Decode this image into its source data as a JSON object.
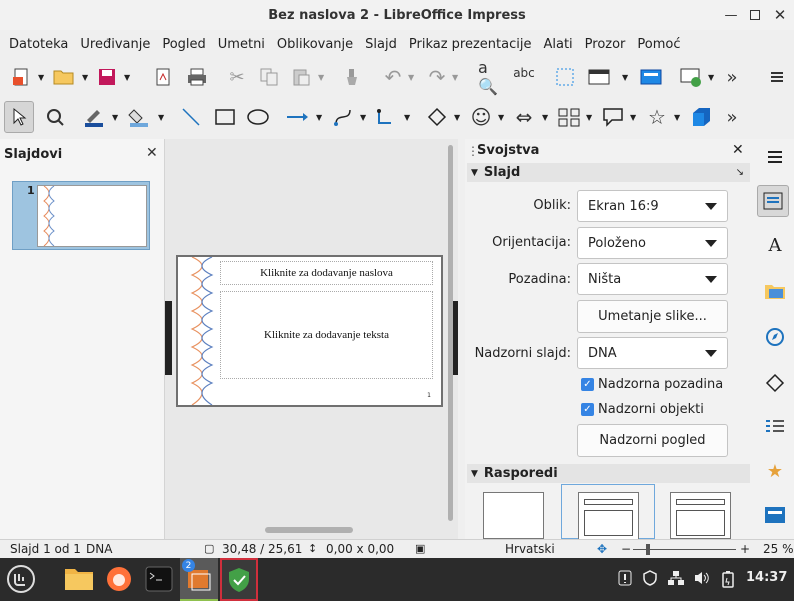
{
  "window": {
    "title": "Bez naslova 2 - LibreOffice Impress"
  },
  "menu": [
    "Datoteka",
    "Uređivanje",
    "Pogled",
    "Umetni",
    "Oblikovanje",
    "Slajd",
    "Prikaz prezentacije",
    "Alati",
    "Prozor",
    "Pomoć"
  ],
  "slides_panel": {
    "title": "Slajdovi",
    "thumb_number": "1"
  },
  "slide": {
    "title_placeholder": "Kliknite za dodavanje naslova",
    "content_placeholder": "Kliknite za dodavanje teksta",
    "page_number": "1"
  },
  "properties": {
    "title": "Svojstva",
    "section_slide": "Slajd",
    "format_label": "Oblik:",
    "format_value": "Ekran 16:9",
    "orientation_label": "Orijentacija:",
    "orientation_value": "Položeno",
    "background_label": "Pozadina:",
    "background_value": "Ništa",
    "insert_image_button": "Umetanje slike...",
    "master_slide_label": "Nadzorni slajd:",
    "master_slide_value": "DNA",
    "master_background_checkbox": "Nadzorna pozadina",
    "master_objects_checkbox": "Nadzorni objekti",
    "master_view_button": "Nadzorni pogled",
    "section_layouts": "Rasporedi"
  },
  "statusbar": {
    "slide_info": "Slajd 1 od 1",
    "master": "DNA",
    "position": "30,48 / 25,61",
    "size": "0,00 x 0,00",
    "language": "Hrvatski",
    "zoom": "25 %"
  },
  "taskbar": {
    "clock": "14:37",
    "badge": "2"
  },
  "colors": {
    "accent": "#3584e4",
    "selection": "#9ec4e0",
    "taskbar": "#2b2b2b"
  }
}
